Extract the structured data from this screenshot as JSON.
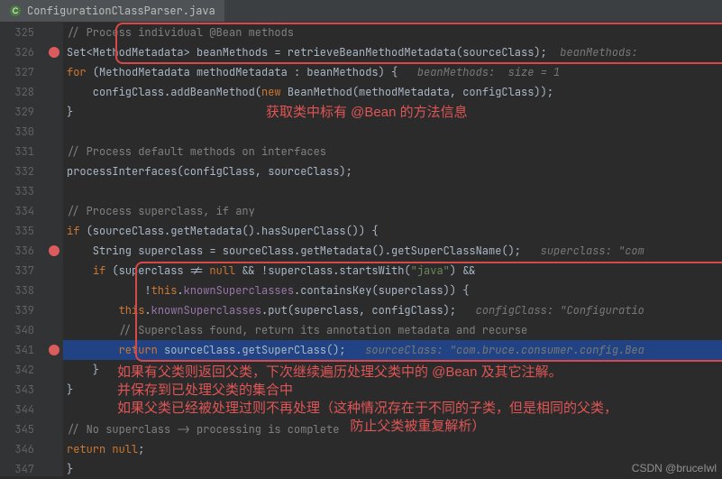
{
  "tab": {
    "filename": "ConfigurationClassParser.java"
  },
  "gutter": {
    "start": 325,
    "end": 347,
    "breakpoints": [
      326,
      336,
      341
    ]
  },
  "code": {
    "l325": "// Process individual @Bean methods",
    "l326_a": "Set<MethodMetadata> beanMethods = retrieveBeanMethodMetadata(sourceClass);",
    "l326_hint": "  beanMethods:",
    "l327_a": "for",
    "l327_b": " (MethodMetadata methodMetadata : beanMethods) {",
    "l327_hint": "   beanMethods:  size = 1",
    "l328_a": "    configClass.addBeanMethod(",
    "l328_b": "new",
    "l328_c": " BeanMethod(methodMetadata, configClass));",
    "l329": "}",
    "l331": "// Process default methods on interfaces",
    "l332": "processInterfaces(configClass, sourceClass);",
    "l334": "// Process superclass, if any",
    "l335_a": "if",
    "l335_b": " (sourceClass.getMetadata().hasSuperClass()) {",
    "l336_a": "    String superclass = sourceClass.getMetadata().getSuperClassName();",
    "l336_hint": "   superclass: \"com",
    "l337_a": "    ",
    "l337_b": "if",
    "l337_c": " (superclass != ",
    "l337_d": "null",
    "l337_e": " && !superclass.startsWith(",
    "l337_f": "\"java\"",
    "l337_g": ") &&",
    "l338_a": "            !",
    "l338_b": "this",
    "l338_c": ".",
    "l338_d": "knownSuperclasses",
    "l338_e": ".containsKey(superclass)) {",
    "l339_a": "        ",
    "l339_b": "this",
    "l339_c": ".",
    "l339_d": "knownSuperclasses",
    "l339_e": ".put(superclass, configClass);",
    "l339_hint": "   configClass: \"Configuratio",
    "l340": "        // Superclass found, return its annotation metadata and recurse",
    "l341_a": "        ",
    "l341_b": "return",
    "l341_c": " sourceClass.getSuperClass();",
    "l341_hint": "   sourceClass: \"com.bruce.consumer.config.Bea",
    "l342": "    }",
    "l343": "}",
    "l345": "// No superclass -> processing is complete",
    "l346_a": "return ",
    "l346_b": "null",
    "l346_c": ";",
    "l347": "}"
  },
  "annotations": {
    "note1": "获取类中标有 @Bean 的方法信息",
    "note2_line1": "如果有父类则返回父类，下次继续遍历处理父类中的 @Bean 及其它注解。",
    "note2_line2": "并保存到已处理父类的集合中",
    "note2_line3": "如果父类已经被处理过则不再处理（这种情况存在于不同的子类，但是相同的父类，",
    "note2_line4": "                                                              防止父类被重复解析）"
  },
  "watermark": "CSDN @bruceIwl"
}
